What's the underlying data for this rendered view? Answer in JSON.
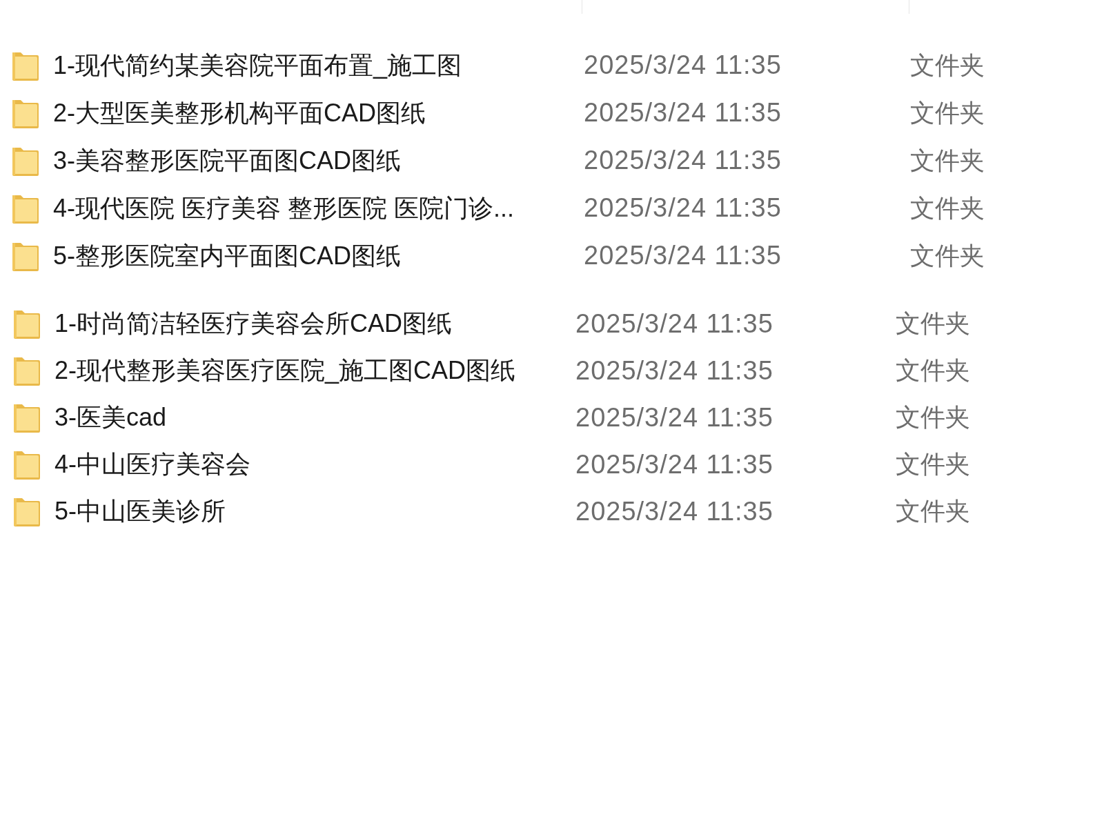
{
  "groups": [
    {
      "rows": [
        {
          "name": "1-现代简约某美容院平面布置_施工图",
          "modified": "2025/3/24 11:35",
          "type": "文件夹"
        },
        {
          "name": "2-大型医美整形机构平面CAD图纸",
          "modified": "2025/3/24 11:35",
          "type": "文件夹"
        },
        {
          "name": "3-美容整形医院平面图CAD图纸",
          "modified": "2025/3/24 11:35",
          "type": "文件夹"
        },
        {
          "name": "4-现代医院 医疗美容 整形医院 医院门诊...",
          "modified": "2025/3/24 11:35",
          "type": "文件夹"
        },
        {
          "name": "5-整形医院室内平面图CAD图纸",
          "modified": "2025/3/24 11:35",
          "type": "文件夹"
        }
      ]
    },
    {
      "rows": [
        {
          "name": "1-时尚简洁轻医疗美容会所CAD图纸",
          "modified": "2025/3/24 11:35",
          "type": "文件夹"
        },
        {
          "name": "2-现代整形美容医疗医院_施工图CAD图纸",
          "modified": "2025/3/24 11:35",
          "type": "文件夹"
        },
        {
          "name": "3-医美cad",
          "modified": "2025/3/24 11:35",
          "type": "文件夹"
        },
        {
          "name": "4-中山医疗美容会",
          "modified": "2025/3/24 11:35",
          "type": "文件夹"
        },
        {
          "name": "5-中山医美诊所",
          "modified": "2025/3/24 11:35",
          "type": "文件夹"
        }
      ]
    }
  ]
}
